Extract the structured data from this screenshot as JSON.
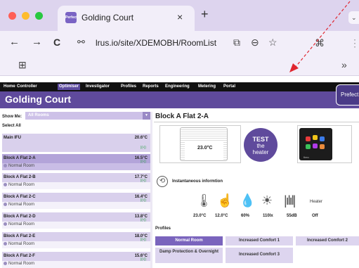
{
  "browser": {
    "tab_title": "Golding Court",
    "tab_favicon_text": "Perfect",
    "url": "lrus.io/site/XDEMOBH/RoomList"
  },
  "app": {
    "nav": [
      "Home",
      "Controller",
      "Optimiser",
      "Investigator",
      "Profiles",
      "Reports",
      "Engineering",
      "Metering",
      "Portal"
    ],
    "active_nav": "Optimiser",
    "site_title": "Golding Court",
    "brand": "Prefect"
  },
  "sidebar": {
    "show_me_label": "Show Me:",
    "show_me_value": "All Rooms",
    "select_all": "Select All",
    "rooms": [
      {
        "name": "Main IFU",
        "temp": "20.6°C",
        "signal": "((•))",
        "profile": ""
      },
      {
        "name": "Block A Flat 2-A",
        "temp": "16.5°C",
        "signal": "((•))",
        "profile": "Normal Room"
      },
      {
        "name": "Block A Flat 2-B",
        "temp": "17.7°C",
        "signal": "((•))",
        "profile": "Normal Room"
      },
      {
        "name": "Block A Flat 2-C",
        "temp": "16.4°C",
        "signal": "((•))",
        "profile": "Normal Room"
      },
      {
        "name": "Block A Flat 2-D",
        "temp": "13.8°C",
        "signal": "((•))",
        "profile": "Normal Room"
      },
      {
        "name": "Block A Flat 2-E",
        "temp": "18.0°C",
        "signal": "((•))",
        "profile": "Normal Room"
      },
      {
        "name": "Block A Flat 2-F",
        "temp": "15.6°C",
        "signal": "((•))",
        "profile": "Normal Room"
      }
    ]
  },
  "main": {
    "title": "Block A Flat 2-A",
    "heater_temp": "23.0°C",
    "test_button": {
      "line1": "TEST",
      "line2": "the",
      "line3": "heater"
    },
    "device_brand": "fireo",
    "info_title": "Instantaneous informtion",
    "sensors": [
      {
        "icon": "thermometer-icon",
        "value": "23.0°C"
      },
      {
        "icon": "touch-icon",
        "value": "12.0°C"
      },
      {
        "icon": "humidity-icon",
        "value": "60%"
      },
      {
        "icon": "light-icon",
        "value": "110lx"
      },
      {
        "icon": "sound-icon",
        "value": "55dB"
      }
    ],
    "heater_label": "Heater",
    "heater_state": "Off",
    "profiles_label": "Profiles",
    "profiles": [
      "Normal Room",
      "Increased Comfort 1",
      "Increased Comfort 2",
      "Damp Protection & Overnight",
      "Increased Comfort 3"
    ],
    "active_profile": "Normal Room"
  },
  "colors": {
    "brand_purple": "#5f4a9c",
    "selected_row": "#b3a4d9",
    "row_bg": "#d9d0ec"
  }
}
